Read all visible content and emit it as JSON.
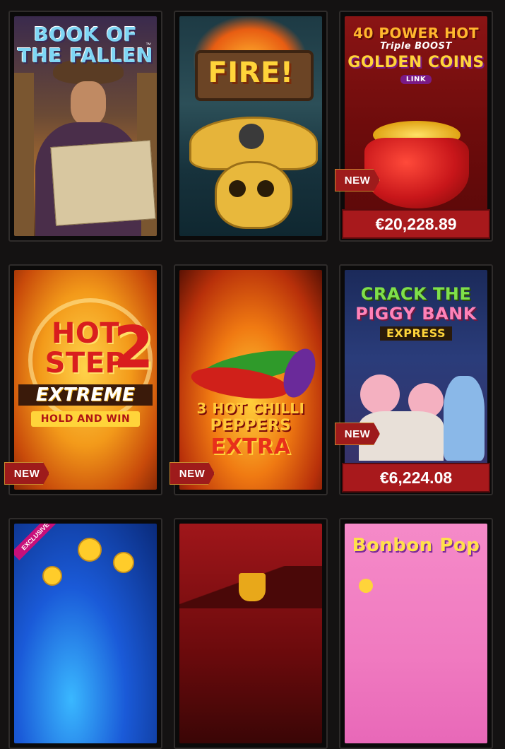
{
  "games": [
    {
      "title_line1": "BOOK OF",
      "title_line2": "THE FALLEN",
      "tm": "™",
      "badge": "",
      "jackpot": ""
    },
    {
      "title_line1": "FIRE!",
      "title_line2": "",
      "badge": "",
      "jackpot": ""
    },
    {
      "title_line1": "40 POWER HOT",
      "title_line2": "Triple BOOST",
      "title_line3": "GOLDEN COINS",
      "title_line4": "LINK",
      "badge": "NEW",
      "jackpot": "€20,228.89"
    },
    {
      "title_line1": "HOT",
      "title_line2": "STEP",
      "title_num": "2",
      "title_line3": "EXTREME",
      "title_line4": "HOLD AND WIN",
      "badge": "NEW",
      "jackpot": ""
    },
    {
      "title_line1": "3 HOT CHILLI",
      "title_line2": "PEPPERS",
      "title_line3": "EXTRA",
      "badge": "NEW",
      "jackpot": ""
    },
    {
      "title_line1": "CRACK THE",
      "title_line2": "PIGGY BANK",
      "title_line3": "EXPRESS",
      "badge": "NEW",
      "jackpot": "€6,224.08"
    },
    {
      "ribbon": "EXCLUSIVE",
      "badge": "",
      "jackpot": ""
    },
    {
      "badge": "",
      "jackpot": ""
    },
    {
      "title_line1": "Bonbon Pop",
      "badge": "",
      "jackpot": ""
    }
  ],
  "colors": {
    "background": "#141212",
    "tile_border": "#2f2c2b",
    "badge_red": "#9e1b1b",
    "jackpot_red": "#a8191c"
  }
}
